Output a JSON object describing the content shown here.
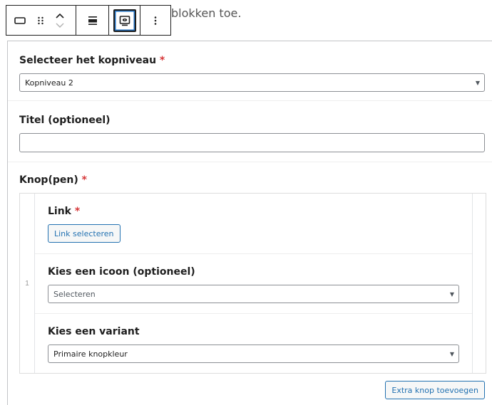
{
  "background_text": "blokken toe.",
  "toolbar": {
    "icons": [
      "block-type-icon",
      "drag-handle-icon",
      "move-up-icon",
      "move-down-icon",
      "align-icon",
      "preview-icon",
      "more-options-icon"
    ]
  },
  "fields": {
    "heading_level": {
      "label": "Selecteer het kopniveau",
      "required": "*",
      "value": "Kopniveau 2"
    },
    "title": {
      "label": "Titel (optioneel)",
      "value": ""
    },
    "buttons": {
      "label": "Knop(pen)",
      "required": "*"
    }
  },
  "repeater": {
    "index": "1",
    "link": {
      "label": "Link",
      "required": "*",
      "button": "Link selecteren"
    },
    "icon": {
      "label": "Kies een icoon (optioneel)",
      "placeholder": "Selecteren"
    },
    "variant": {
      "label": "Kies een variant",
      "value": "Primaire knopkleur"
    }
  },
  "add_button": "Extra knop toevoegen",
  "colors": {
    "accent": "#2271b1",
    "required": "#d63638",
    "border": "#8c8f94"
  }
}
